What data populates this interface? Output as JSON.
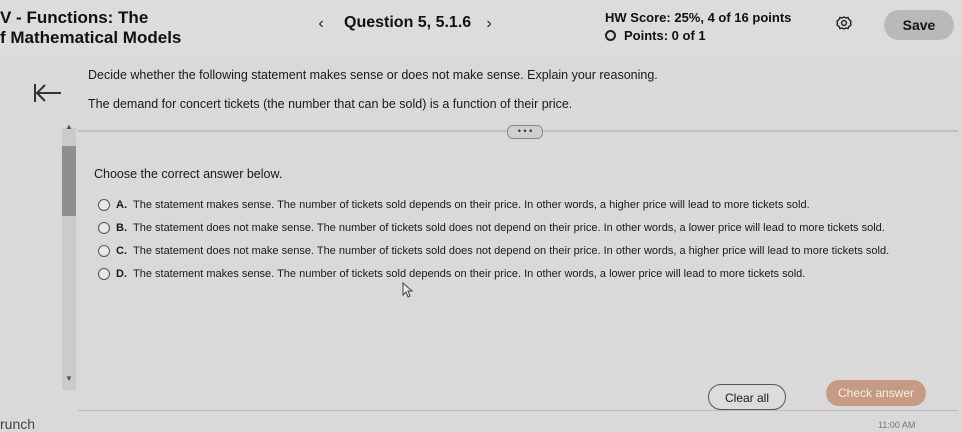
{
  "header": {
    "title_line1": "V - Functions: The",
    "title_line2": "f Mathematical Models",
    "question_label": "Question 5, 5.1.6",
    "score": "HW Score: 25%, 4 of 16 points",
    "points": "Points: 0 of 1",
    "save_label": "Save",
    "icons": {
      "prev": "chevron-left-icon",
      "next": "chevron-right-icon",
      "settings": "gear-icon"
    }
  },
  "question": {
    "prompt": "Decide whether the following statement makes sense or does not make sense. Explain your reasoning.",
    "statement": "The demand for concert tickets (the number that can be sold) is a function of their price.",
    "more_label": "• • •",
    "instruction": "Choose the correct answer below.",
    "options": [
      {
        "letter": "A.",
        "text": "The statement makes sense. The number of tickets sold depends on their price. In other words, a higher price will lead to more tickets sold."
      },
      {
        "letter": "B.",
        "text": "The statement does not make sense. The number of tickets sold does not depend on their price. In other words, a lower price will lead to more tickets sold."
      },
      {
        "letter": "C.",
        "text": "The statement does not make sense. The number of tickets sold does not depend on their price. In other words, a higher price will lead to more tickets sold."
      },
      {
        "letter": "D.",
        "text": "The statement makes sense. The number of tickets sold depends on their price. In other words, a lower price will lead to more tickets sold."
      }
    ]
  },
  "footer": {
    "clear_label": "Clear all",
    "check_label": "Check answer",
    "taskbar_text": "runch",
    "clock_text": "11:00 AM"
  },
  "colors": {
    "background": "#d9d9d9",
    "check_button": "#c79a84",
    "save_button": "#b9b9b9"
  }
}
